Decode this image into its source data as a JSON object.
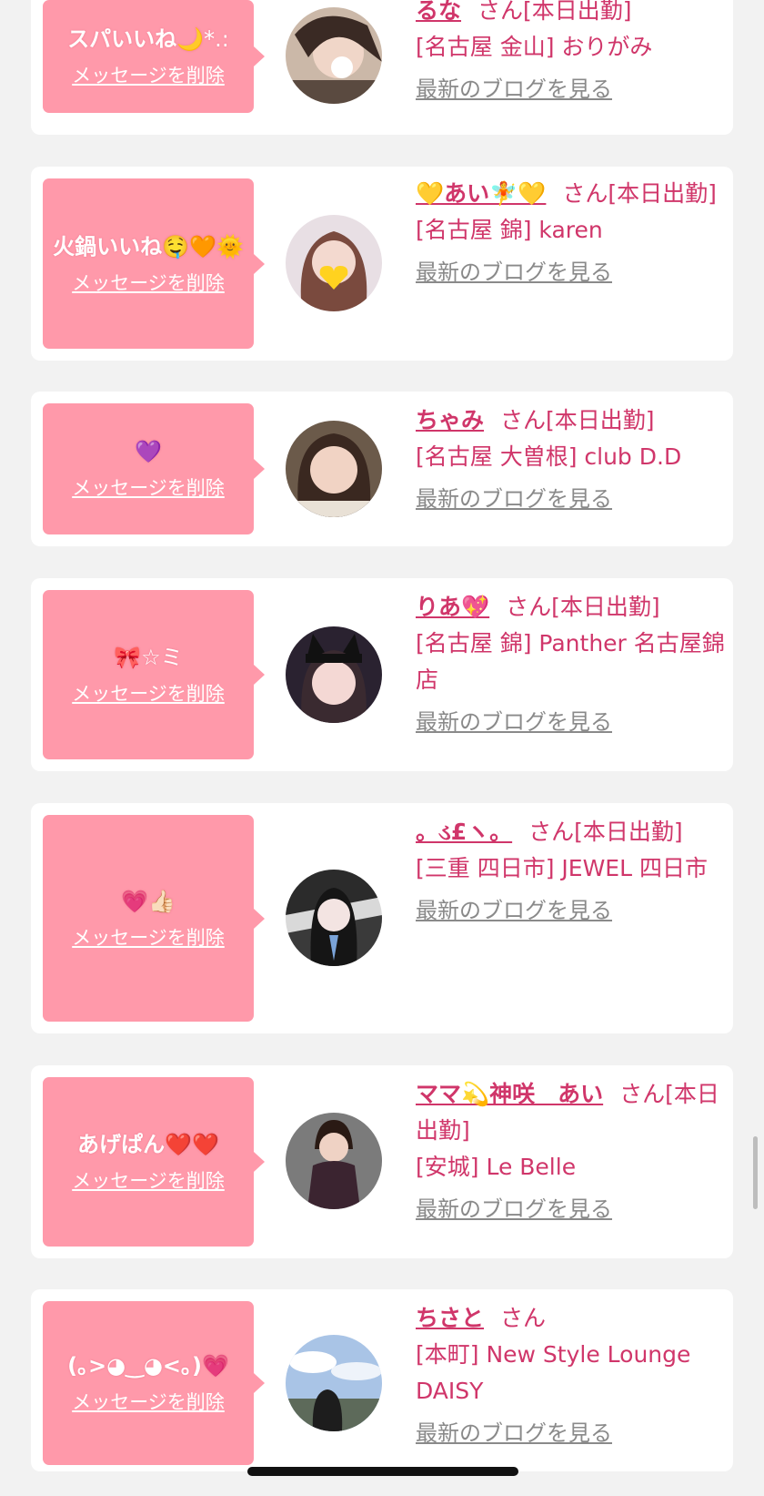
{
  "colors": {
    "accent": "#d0366a",
    "bubble": "#ff99aa",
    "link_gray": "#8a8a8a",
    "background": "#f2f2f2"
  },
  "entries": [
    {
      "message": "スパいいね",
      "message_emoji": "🌙*.:",
      "delete_label": "メッセージを削除",
      "name": "るな",
      "suffix": "さん[本日出勤]",
      "shop": "[名古屋 金山] おりがみ",
      "blog_label": "最新のブログを見る",
      "avatar_icon": "avatar-photo-icon"
    },
    {
      "message": "火鍋いいね",
      "message_emoji": "🤤🧡🌞",
      "delete_label": "メッセージを削除",
      "name": "💛あい🧚💛",
      "suffix": "さん[本日出勤]",
      "shop": "[名古屋 錦] karen",
      "blog_label": "最新のブログを見る",
      "avatar_icon": "avatar-photo-icon"
    },
    {
      "message": "",
      "message_emoji": "💜",
      "delete_label": "メッセージを削除",
      "name": "ちゃみ",
      "suffix": "さん[本日出勤]",
      "shop": "[名古屋 大曽根] club D.D",
      "blog_label": "最新のブログを見る",
      "avatar_icon": "avatar-photo-icon"
    },
    {
      "message": "",
      "message_emoji": "🎀☆ミ",
      "delete_label": "メッセージを削除",
      "name": "りあ💖",
      "suffix": "さん[本日出勤]",
      "shop": "[名古屋 錦] Panther 名古屋錦店",
      "blog_label": "最新のブログを見る",
      "avatar_icon": "avatar-photo-icon"
    },
    {
      "message": "",
      "message_emoji": "💗👍🏻",
      "delete_label": "メッセージを削除",
      "name": "。ડ£ヽ。",
      "suffix": "さん[本日出勤]",
      "shop": "[三重 四日市] JEWEL 四日市",
      "blog_label": "最新のブログを見る",
      "avatar_icon": "avatar-photo-icon"
    },
    {
      "message": "あげぱん",
      "message_emoji": "❤️❤️",
      "delete_label": "メッセージを削除",
      "name": "ママ💫神咲　あい",
      "suffix": "さん[本日出勤]",
      "shop": "[安城] Le Belle",
      "blog_label": "最新のブログを見る",
      "avatar_icon": "avatar-photo-icon"
    },
    {
      "message": "(｡>◕‿◕<｡)",
      "message_emoji": "💗",
      "delete_label": "メッセージを削除",
      "name": "ちさと",
      "suffix": "さん",
      "shop": "[本町] New Style Lounge DAISY",
      "blog_label": "最新のブログを見る",
      "avatar_icon": "avatar-photo-icon"
    }
  ]
}
